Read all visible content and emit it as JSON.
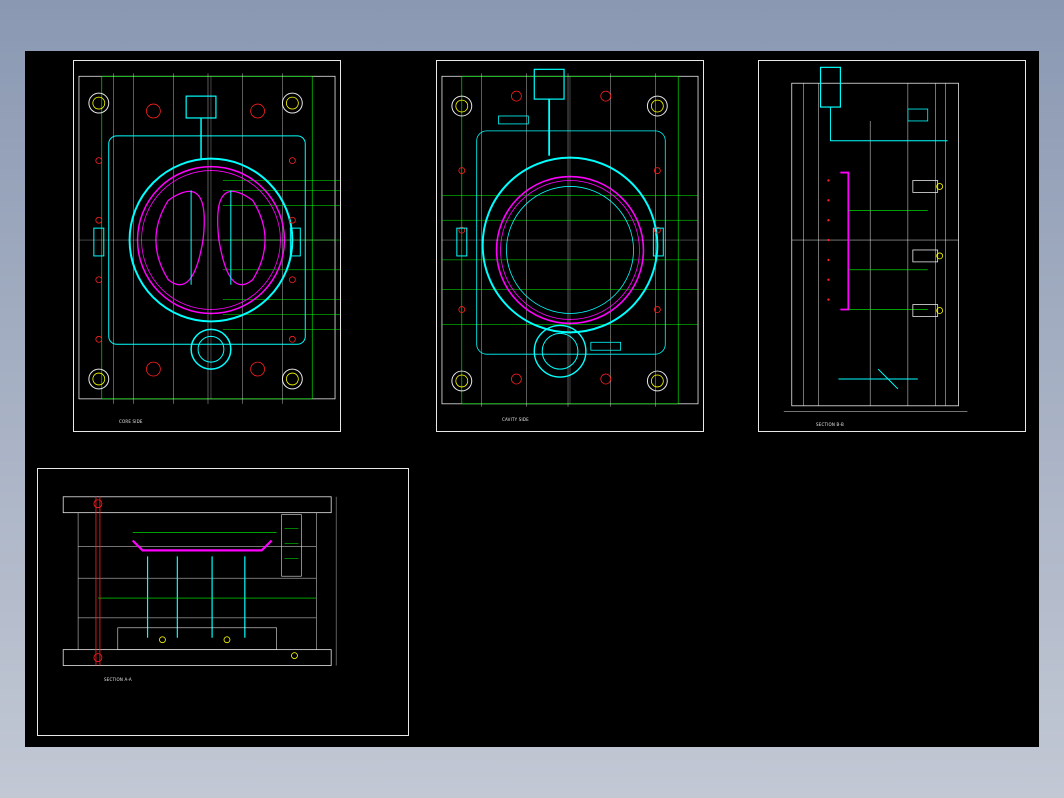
{
  "drawing": {
    "sheets": [
      {
        "id": "plan-view-a",
        "caption": "CORE SIDE"
      },
      {
        "id": "plan-view-b",
        "caption": "CAVITY SIDE"
      },
      {
        "id": "side-section",
        "caption": "SECTION B-B"
      },
      {
        "id": "front-section",
        "caption": "SECTION A-A"
      }
    ]
  },
  "colors": {
    "background": "#000000",
    "sheet_border": "#e8e8e8",
    "cyan": "#00ffff",
    "magenta": "#ff00ff",
    "green": "#00ff00",
    "red": "#ff2020",
    "yellow": "#ffff00",
    "white": "#e8e8e8"
  }
}
